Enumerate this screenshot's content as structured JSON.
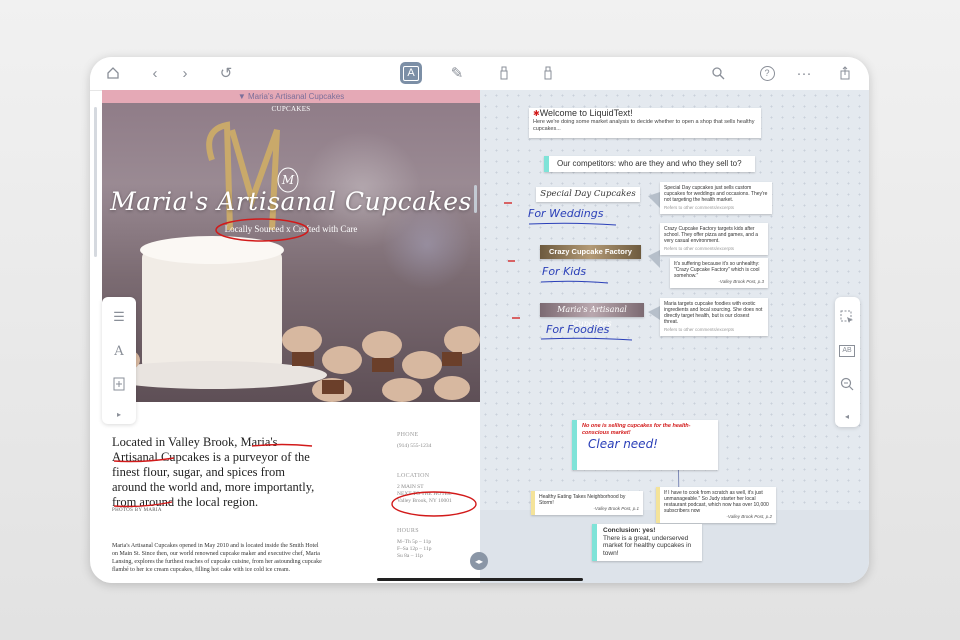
{
  "toolbar": {
    "icons": [
      "home-icon",
      "back-icon",
      "forward-icon",
      "undo-icon",
      "text-select-icon",
      "pen-icon",
      "highlighter-icon",
      "eraser-icon",
      "search-icon",
      "help-icon",
      "more-icon",
      "share-icon"
    ]
  },
  "document": {
    "header_strip": "▼ Maria's Artisanal Cupcakes",
    "top_label": "CUPCAKES",
    "monogram": "M",
    "title": "Maria's Artisanal Cupcakes",
    "tagline": "Locally Sourced x Crafted with Care",
    "intro": "Located in Valley Brook, Maria's Artisanal Cupcakes is a purveyor of the finest flour, sugar, and spices from around the world and, more importantly, from around the local region.",
    "photo_credit": "PHOTOS BY MARIA",
    "body": "Maria's Artisanal Cupcakes opened in May 2010 and is located inside the Smith Hotel on Main St. Since then, our world renowned cupcake maker and executive chef, Maria Lansing, explores the furthest reaches of cupcake cuisine, from her astounding cupcake flambé to her ice cream cupcakes, filling hot cake with ice cold ice cream.",
    "phone_label": "PHONE",
    "phone": "(914) 555-1234",
    "location_label": "LOCATION",
    "location_lines": [
      "2 MAIN ST",
      "NEXT TO THE HOTEL",
      "Valley Brook, NY 10001"
    ],
    "hours_label": "HOURS",
    "hours_lines": [
      "M–Th 5p – 11p",
      "F–Sa 12p – 11p",
      "Su 8a – 11p"
    ]
  },
  "workspace": {
    "welcome_title": "Welcome to LiquidText!",
    "welcome_body": "Here we're doing some market analysis to decide whether to open a shop that sells healthy cupcakes...",
    "competitors_heading": "Our competitors: who are they and who they sell to?",
    "competitors": [
      {
        "name": "Special Day Cupcakes",
        "handwriting": "For Weddings",
        "note": "Special Day cupcakes just sells custom cupcakes for weddings and occasions. They're not targeting the health market.",
        "refer": "Refers to other comments/excerpts"
      },
      {
        "name": "Crazy Cupcake Factory",
        "handwriting": "For Kids",
        "note": "Crazy Cupcake Factory targets kids after school. They offer pizza and games, and a very casual environment.",
        "refer": "Refers to other comments/excerpts",
        "quote": "It's suffering because it's so unhealthy: \"Crazy Cupcake Factory\" which is cool somehow.\"",
        "quote_source": "-Valley Brook Post, p.3"
      },
      {
        "name": "Maria's Artisanal Cupcakes",
        "handwriting": "For Foodies",
        "note": "Maria targets cupcake foodies with exotic ingredients and local sourcing. She does not directly target health, but is our closest threat.",
        "refer": "Refers to other comments/excerpts"
      }
    ],
    "need_note": "No one is selling cupcakes for the health-conscious market!",
    "need_handwriting": "Clear need!",
    "evidence_left": "Healthy Eating Takes Neighborhood by Storm!",
    "evidence_left_source": "-Valley Brook Post, p.1",
    "evidence_right": "If I have to cook from scratch as well, it's just unmanageable.\" So Judy starter her local restaurant podcast, which now has over 10,000 subscribers now",
    "evidence_right_source": "-Valley Brook Post, p.2",
    "conclusion_title": "Conclusion: yes!",
    "conclusion_body": "There is a great, underserved market for healthy cupcakes in town!"
  },
  "colors": {
    "accent": "#7c8fa6",
    "handwriting": "#2a3fb8",
    "annotation_red": "#d21a1a",
    "teal_tab": "#7fe3d8",
    "yellow_tab": "#f4e39a"
  }
}
